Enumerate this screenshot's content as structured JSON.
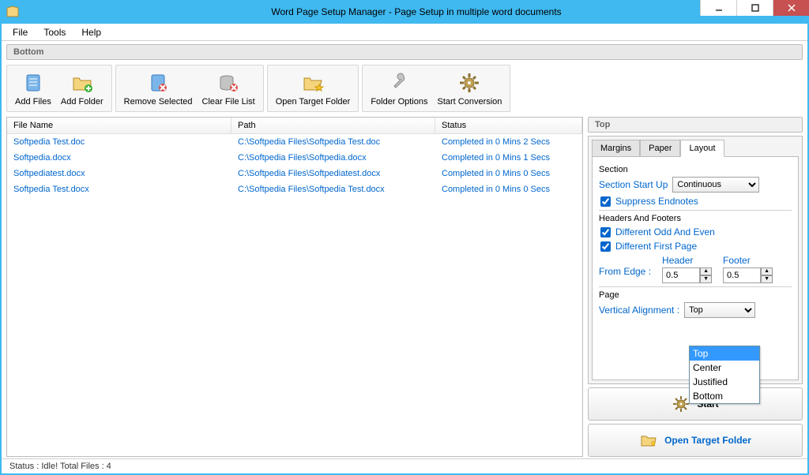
{
  "window": {
    "title": "Word Page Setup Manager - Page Setup in multiple word documents"
  },
  "menubar": {
    "items": [
      "File",
      "Tools",
      "Help"
    ]
  },
  "label_bottom": "Bottom",
  "toolbar": {
    "add_files": "Add Files",
    "add_folder": "Add Folder",
    "remove_selected": "Remove Selected",
    "clear_list": "Clear File List",
    "open_target": "Open Target Folder",
    "folder_options": "Folder Options",
    "start_conv": "Start Conversion"
  },
  "file_list": {
    "headers": {
      "name": "File Name",
      "path": "Path",
      "status": "Status"
    },
    "rows": [
      {
        "name": "Softpedia Test.doc",
        "path": "C:\\Softpedia Files\\Softpedia Test.doc",
        "status": "Completed in 0 Mins 2 Secs"
      },
      {
        "name": "Softpedia.docx",
        "path": "C:\\Softpedia Files\\Softpedia.docx",
        "status": "Completed in 0 Mins 1 Secs"
      },
      {
        "name": "Softpediatest.docx",
        "path": "C:\\Softpedia Files\\Softpediatest.docx",
        "status": "Completed in 0 Mins 0 Secs"
      },
      {
        "name": "Softpedia Test.docx",
        "path": "C:\\Softpedia Files\\Softpedia Test.docx",
        "status": "Completed in 0 Mins 0 Secs"
      }
    ]
  },
  "right": {
    "top_label": "Top",
    "tabs": {
      "margins": "Margins",
      "paper": "Paper",
      "layout": "Layout"
    },
    "section_label": "Section",
    "section_start": "Section Start Up",
    "section_start_value": "Continuous",
    "suppress_endnotes": "Suppress Endnotes",
    "hf_label": "Headers And Footers",
    "diff_odd_even": "Different Odd And Even",
    "diff_first": "Different First Page",
    "from_edge": "From Edge :",
    "header": "Header",
    "footer": "Footer",
    "header_val": "0.5",
    "footer_val": "0.5",
    "page_label": "Page",
    "valign": "Vertical Alignment :",
    "valign_value": "Top",
    "valign_options": [
      "Top",
      "Center",
      "Justified",
      "Bottom"
    ]
  },
  "big_buttons": {
    "start": "Start",
    "open_target": "Open Target Folder"
  },
  "statusbar": "Status  :  Idle!  Total Files : 4"
}
